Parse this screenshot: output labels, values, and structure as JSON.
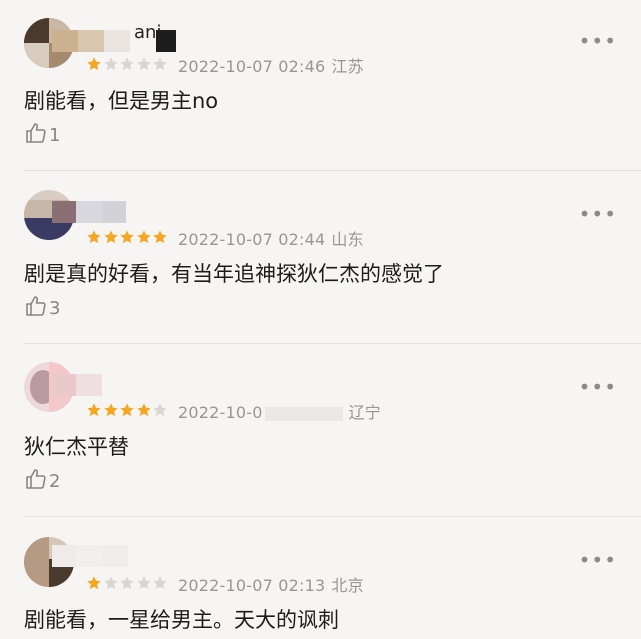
{
  "comments": [
    {
      "username_fragment": "anj",
      "rating": 1,
      "date": "2022-10-07 02:46",
      "location": "江苏",
      "text": "剧能看，但是男主no",
      "likes": "1"
    },
    {
      "rating": 5,
      "date": "2022-10-07 02:44",
      "location": "山东",
      "text": "剧是真的好看，有当年追神探狄仁杰的感觉了",
      "likes": "3"
    },
    {
      "rating": 4,
      "date": "2022-10-0",
      "location": "辽宁",
      "text": "狄仁杰平替",
      "likes": "2"
    },
    {
      "rating": 1,
      "date": "2022-10-07 02:13",
      "location": "北京",
      "text": "剧能看，一星给男主。天大的讽刺",
      "likes": ""
    }
  ],
  "more_icon": "more-dots-icon",
  "like_icon": "thumbs-up-icon",
  "colors": {
    "star_on": "#f5a623",
    "star_off": "#d8d5d3",
    "meta_text": "#9a9592",
    "background": "#f7f5f4"
  }
}
